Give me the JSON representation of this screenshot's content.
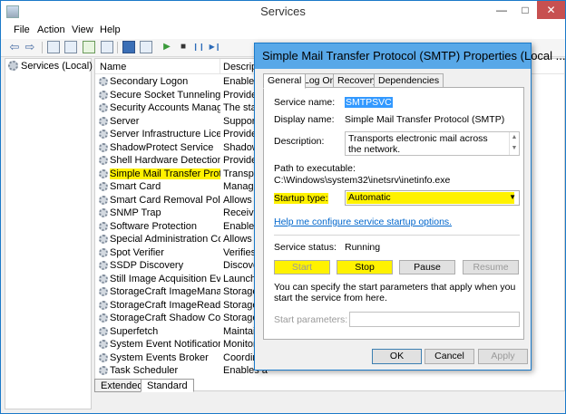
{
  "window": {
    "title": "Services",
    "min": "—",
    "max": "□",
    "close": "✕"
  },
  "menu": [
    "File",
    "Action",
    "View",
    "Help"
  ],
  "toolbar": {
    "back": "⇦",
    "forward": "⇨",
    "start": "▶",
    "stop": "■",
    "pause": "❙❙",
    "restart": "▶❙"
  },
  "tree": {
    "root": "Services (Local)"
  },
  "list": {
    "columns": {
      "name": "Name",
      "description": "Descrip"
    },
    "rows": [
      {
        "name": "Secondary Logon",
        "desc": "Enables s"
      },
      {
        "name": "Secure Socket Tunneling Pr...",
        "desc": "Provides"
      },
      {
        "name": "Security Accounts Manager",
        "desc": "The start"
      },
      {
        "name": "Server",
        "desc": "Supports"
      },
      {
        "name": "Server Infrastructure Licens...",
        "desc": "Provides"
      },
      {
        "name": "ShadowProtect Service",
        "desc": "ShadowP"
      },
      {
        "name": "Shell Hardware Detection",
        "desc": "Provides"
      },
      {
        "name": "Simple Mail Transfer Protoc...",
        "desc": "Transpor",
        "selected": true
      },
      {
        "name": "Smart Card",
        "desc": "Manages"
      },
      {
        "name": "Smart Card Removal Policy",
        "desc": "Allows th"
      },
      {
        "name": "SNMP Trap",
        "desc": "Receives"
      },
      {
        "name": "Software Protection",
        "desc": "Enables t"
      },
      {
        "name": "Special Administration Con...",
        "desc": "Allows ad"
      },
      {
        "name": "Spot Verifier",
        "desc": "Verifies p"
      },
      {
        "name": "SSDP Discovery",
        "desc": "Discover"
      },
      {
        "name": "Still Image Acquisition Events",
        "desc": "Launche"
      },
      {
        "name": "StorageCraft ImageManager",
        "desc": "StorageC"
      },
      {
        "name": "StorageCraft ImageReady",
        "desc": "StorageC"
      },
      {
        "name": "StorageCraft Shadow Copy ...",
        "desc": "StorageC"
      },
      {
        "name": "Superfetch",
        "desc": "Maintain"
      },
      {
        "name": "System Event Notification S...",
        "desc": "Monitors"
      },
      {
        "name": "System Events Broker",
        "desc": "Coordina"
      },
      {
        "name": "Task Scheduler",
        "desc": "Enables a"
      }
    ]
  },
  "view_tabs": {
    "extended": "Extended",
    "standard": "Standard"
  },
  "dialog": {
    "title": "Simple Mail Transfer Protocol (SMTP) Properties (Local ...",
    "tabs": [
      "General",
      "Log On",
      "Recovery",
      "Dependencies"
    ],
    "service_name_label": "Service name:",
    "service_name": "SMTPSVC",
    "display_name_label": "Display name:",
    "display_name": "Simple Mail Transfer Protocol (SMTP)",
    "description_label": "Description:",
    "description": "Transports electronic mail across the network.",
    "path_label": "Path to executable:",
    "path": "C:\\Windows\\system32\\inetsrv\\inetinfo.exe",
    "startup_label": "Startup type:",
    "startup_value": "Automatic",
    "help_link": "Help me configure service startup options.",
    "status_label": "Service status:",
    "status_value": "Running",
    "buttons": {
      "start": "Start",
      "stop": "Stop",
      "pause": "Pause",
      "resume": "Resume"
    },
    "params_note": "You can specify the start parameters that apply when you start the service from here.",
    "params_label": "Start parameters:",
    "ok": "OK",
    "cancel": "Cancel",
    "apply": "Apply"
  }
}
